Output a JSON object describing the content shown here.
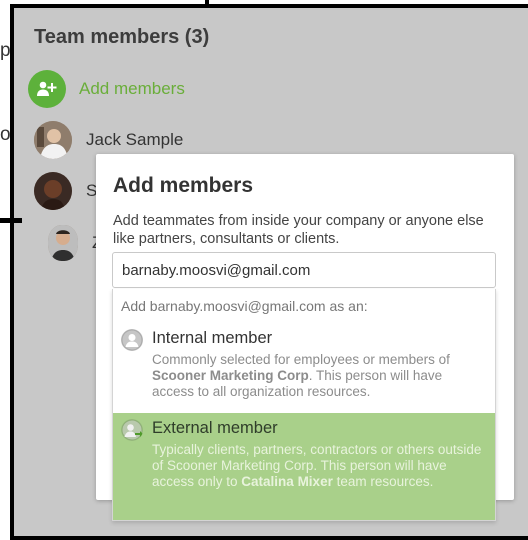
{
  "left_edge": {
    "char1": "p",
    "char2": "o"
  },
  "team": {
    "title": "Team members (3)",
    "add_label": "Add members",
    "members": [
      {
        "name": "Jack Sample"
      },
      {
        "name": "S"
      },
      {
        "name": "Z"
      }
    ]
  },
  "modal": {
    "title": "Add members",
    "description": "Add teammates from inside your company or anyone else like partners, consultants or clients.",
    "email_value": "barnaby.moosvi@gmail.com",
    "dropdown": {
      "header": "Add barnaby.moosvi@gmail.com as an:",
      "internal": {
        "title": "Internal member",
        "desc_pre": "Commonly selected for employees or members of ",
        "desc_bold": "Scooner Marketing Corp",
        "desc_post": ". This person will have access to all organization resources."
      },
      "external": {
        "title": "External member",
        "desc_pre": "Typically clients, partners, contractors or others outside of Scooner Marketing Corp. This person will have access only to ",
        "desc_bold": "Catalina Mixer",
        "desc_post": " team resources."
      }
    }
  },
  "colors": {
    "accent_green": "#5db13b",
    "selected_option": "#a9d08a",
    "overlay_gray": "#c8c8c8"
  }
}
